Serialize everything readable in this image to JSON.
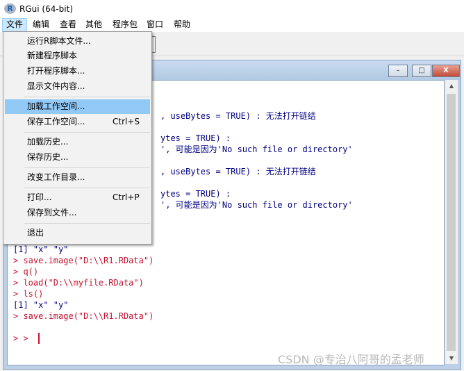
{
  "window": {
    "title": "RGui (64-bit)",
    "icon": "r-logo-icon"
  },
  "menubar": {
    "items": [
      {
        "label": "文件",
        "active": true
      },
      {
        "label": "编辑"
      },
      {
        "label": "查看"
      },
      {
        "label": "其他"
      },
      {
        "label": "程序包"
      },
      {
        "label": "窗口"
      },
      {
        "label": "帮助"
      }
    ]
  },
  "file_menu": {
    "items": [
      {
        "label": "运行R脚本文件..."
      },
      {
        "label": "新建程序脚本"
      },
      {
        "label": "打开程序脚本..."
      },
      {
        "label": "显示文件内容..."
      },
      {
        "label": "加载工作空间...",
        "highlighted": true
      },
      {
        "label": "保存工作空间...",
        "shortcut": "Ctrl+S"
      },
      {
        "label": "加载历史..."
      },
      {
        "label": "保存历史..."
      },
      {
        "label": "改变工作目录..."
      },
      {
        "label": "打印...",
        "shortcut": "Ctrl+P"
      },
      {
        "label": "保存到文件..."
      },
      {
        "label": "退出"
      }
    ]
  },
  "console": {
    "window_buttons": {
      "minimize": "–",
      "maximize": "□",
      "close": "X"
    },
    "lines": [
      {
        "text": ", useBytes = TRUE) : 无法打开链结",
        "kind": "output"
      },
      {
        "text": "ytes = TRUE) :",
        "kind": "output"
      },
      {
        "text": "', 可能是因为'No such file or directory'",
        "kind": "output"
      },
      {
        "text": ", useBytes = TRUE) : 无法打开链结",
        "kind": "output"
      },
      {
        "text": "ytes = TRUE) :",
        "kind": "output"
      },
      {
        "text": "', 可能是因为'No such file or directory'",
        "kind": "output"
      },
      {
        "text": "[1] \"x\" \"y\"",
        "kind": "output"
      },
      {
        "text": "> save.image(\"D:\\\\R1.RData\")",
        "kind": "command"
      },
      {
        "text": "> q()",
        "kind": "command"
      },
      {
        "text": "> load(\"D:\\\\myfile.RData\")",
        "kind": "command"
      },
      {
        "text": "> ls()",
        "kind": "command"
      },
      {
        "text": "[1] \"x\" \"y\"",
        "kind": "output"
      },
      {
        "text": "> save.image(\"D:\\\\R1.RData\")",
        "kind": "command"
      },
      {
        "text": "> >",
        "kind": "command"
      }
    ]
  },
  "watermark": "CSDN @专治八阿哥的孟老师",
  "colors": {
    "output_text": "#000080",
    "command_text": "#c8102e",
    "menu_highlight": "#91c9f7"
  }
}
